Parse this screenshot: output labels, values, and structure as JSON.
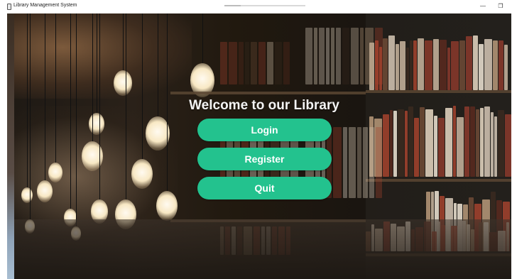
{
  "window": {
    "title": "Library Management System",
    "minimize_glyph": "—",
    "maximize_glyph": "❐",
    "progress": 0.2
  },
  "main": {
    "welcome_text": "Welcome to our Library",
    "buttons": [
      {
        "label": "Login"
      },
      {
        "label": "Register"
      },
      {
        "label": "Quit"
      }
    ]
  },
  "colors": {
    "button_bg": "#23c28e",
    "button_text": "#ffffff",
    "welcome_text": "#f3f3f3"
  },
  "icons": {
    "app": "app-window-icon",
    "minimize": "minimize-icon",
    "maximize": "restore-icon"
  }
}
